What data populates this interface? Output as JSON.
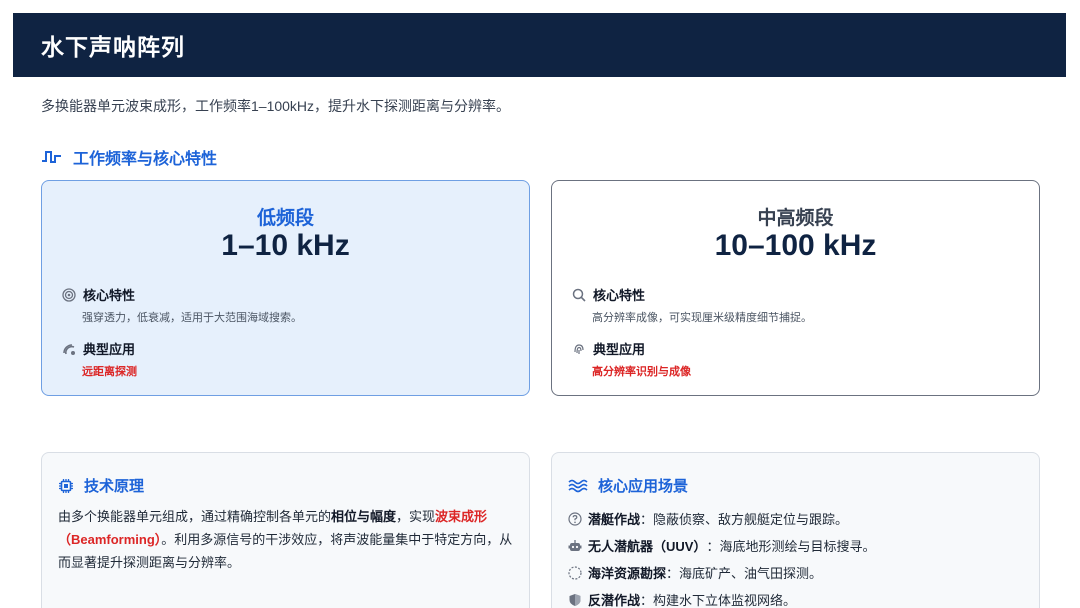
{
  "header": {
    "title": "水下声呐阵列"
  },
  "subtitle": "多换能器单元波束成形，工作频率1–100kHz，提升水下探测距离与分辨率。",
  "section": {
    "title": "工作频率与核心特性"
  },
  "bands": [
    {
      "name": "低频段",
      "range": "1–10 kHz",
      "feature_label": "核心特性",
      "feature_desc": "强穿透力，低衰减，适用于大范围海域搜索。",
      "app_label": "典型应用",
      "app_value": "远距离探测"
    },
    {
      "name": "中高频段",
      "range": "10–100 kHz",
      "feature_label": "核心特性",
      "feature_desc": "高分辨率成像，可实现厘米级精度细节捕捉。",
      "app_label": "典型应用",
      "app_value": "高分辨率识别与成像"
    }
  ],
  "principle": {
    "title": "技术原理",
    "text1": "由多个换能器单元组成，通过精确控制各单元的",
    "bold1": "相位与幅度",
    "text2": "，实现",
    "red1": "波束成形（Beamforming）",
    "text3": "。利用多源信号的干涉效应，将声波能量集中于特定方向，从而显著提升探测距离与分辨率。"
  },
  "scenes": {
    "title": "核心应用场景",
    "items": [
      {
        "label": "潜艇作战",
        "desc": "：隐蔽侦察、敌方舰艇定位与跟踪。",
        "icon": "question-circle-icon"
      },
      {
        "label": "无人潜航器（UUV）",
        "desc": "：海底地形测绘与目标搜寻。",
        "icon": "robot-icon"
      },
      {
        "label": "海洋资源勘探",
        "desc": "：海底矿产、油气田探测。",
        "icon": "dotted-circle-icon"
      },
      {
        "label": "反潜作战",
        "desc": "：构建水下立体监视网络。",
        "icon": "shield-icon"
      }
    ]
  },
  "colors": {
    "header_bg": "#0f2342",
    "accent": "#1d63d8",
    "highlight": "#dc2626"
  }
}
